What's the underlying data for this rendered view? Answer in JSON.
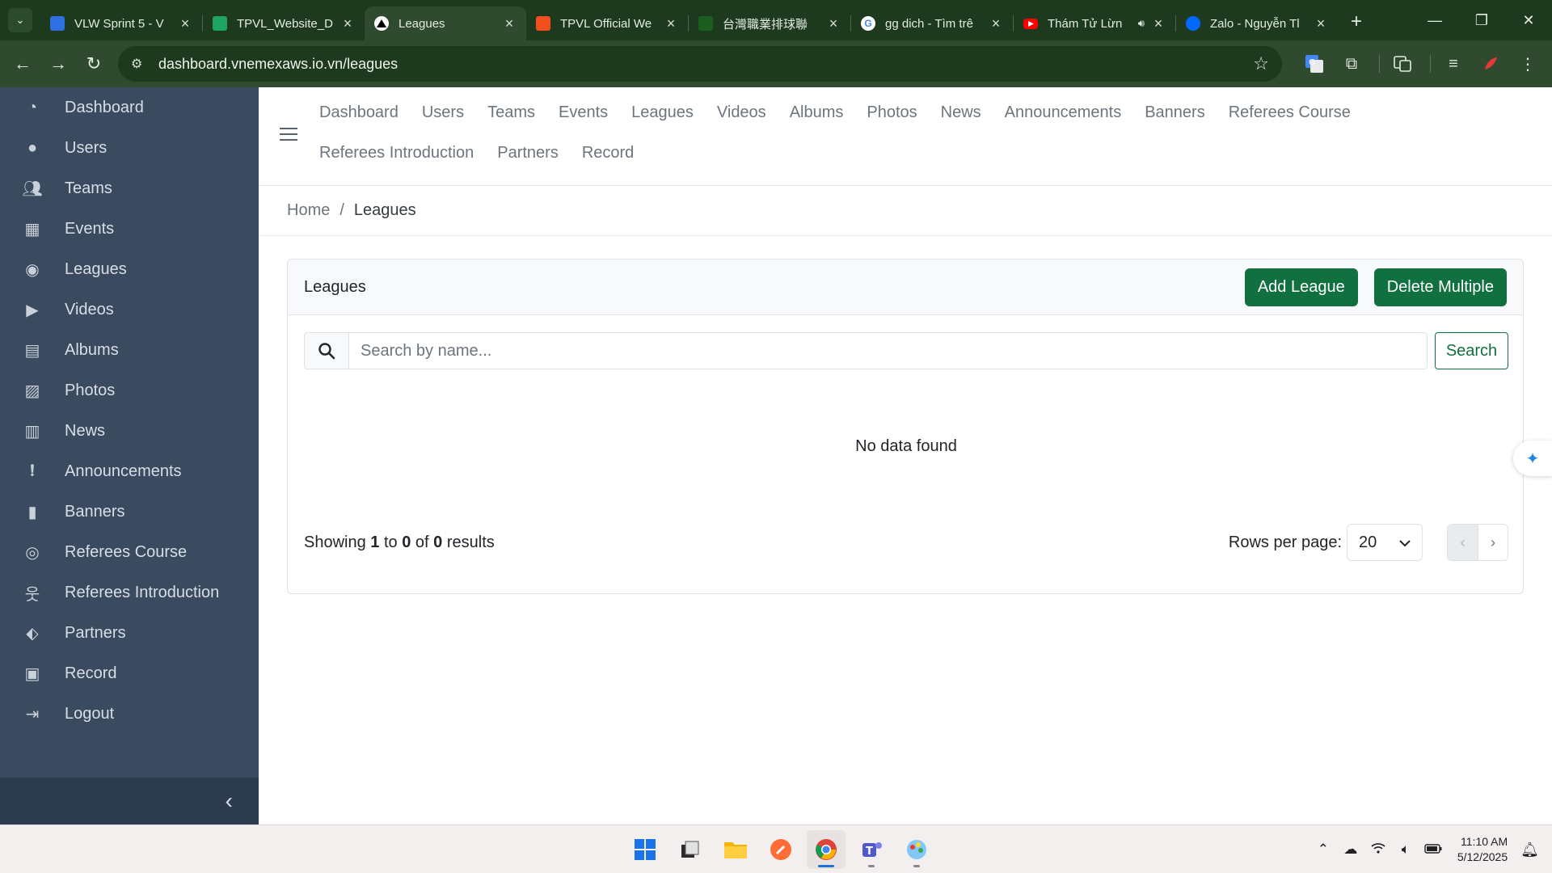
{
  "browser": {
    "tabs": [
      {
        "title": "VLW Sprint 5 - V",
        "icon": "jira-icon",
        "color": "#2f6fe0",
        "active": false
      },
      {
        "title": "TPVL_Website_D",
        "icon": "sheets-icon",
        "color": "#1ea362",
        "active": false
      },
      {
        "title": "Leagues",
        "icon": "vercel-icon",
        "color": "#000000",
        "active": true
      },
      {
        "title": "TPVL Official We",
        "icon": "figma-icon",
        "color": "#f24e1e",
        "active": false
      },
      {
        "title": "台灣職業排球聯",
        "icon": "league-icon",
        "color": "#1b5e20",
        "active": false
      },
      {
        "title": "gg dich - Tìm trê",
        "icon": "google-icon",
        "color": "#ffffff",
        "active": false
      },
      {
        "title": "Thám Tử Lừn",
        "icon": "youtube-icon",
        "color": "#ff0000",
        "active": false,
        "audio": true
      },
      {
        "title": "Zalo - Nguyễn Tl",
        "icon": "zalo-icon",
        "color": "#0068ff",
        "active": false
      }
    ],
    "url": "dashboard.vnemexaws.io.vn/leagues"
  },
  "sidebar": {
    "items": [
      {
        "label": "Dashboard",
        "icon": "gauge-icon"
      },
      {
        "label": "Users",
        "icon": "user-circle-icon"
      },
      {
        "label": "Teams",
        "icon": "users-icon"
      },
      {
        "label": "Events",
        "icon": "calendar-icon"
      },
      {
        "label": "Leagues",
        "icon": "volleyball-icon"
      },
      {
        "label": "Videos",
        "icon": "play-icon"
      },
      {
        "label": "Albums",
        "icon": "album-icon"
      },
      {
        "label": "Photos",
        "icon": "image-icon"
      },
      {
        "label": "News",
        "icon": "newspaper-icon"
      },
      {
        "label": "Announcements",
        "icon": "comment-alert-icon"
      },
      {
        "label": "Banners",
        "icon": "banner-icon"
      },
      {
        "label": "Referees Course",
        "icon": "whistle-icon"
      },
      {
        "label": "Referees Introduction",
        "icon": "person-icon"
      },
      {
        "label": "Partners",
        "icon": "handshake-icon"
      },
      {
        "label": "Record",
        "icon": "record-icon"
      },
      {
        "label": "Logout",
        "icon": "logout-icon"
      }
    ]
  },
  "topnav": {
    "links": [
      "Dashboard",
      "Users",
      "Teams",
      "Events",
      "Leagues",
      "Videos",
      "Albums",
      "Photos",
      "News",
      "Announcements",
      "Banners",
      "Referees Course",
      "Referees Introduction",
      "Partners",
      "Record"
    ]
  },
  "breadcrumb": {
    "home": "Home",
    "separator": "/",
    "current": "Leagues"
  },
  "card": {
    "title": "Leagues",
    "add_label": "Add League",
    "delete_label": "Delete Multiple",
    "search_placeholder": "Search by name...",
    "search_button": "Search",
    "empty_text": "No data found",
    "showing_prefix": "Showing",
    "showing_from": "1",
    "showing_to_word": "to",
    "showing_to": "0",
    "showing_of_word": "of",
    "showing_total": "0",
    "showing_suffix": "results",
    "rows_label": "Rows per page:",
    "rows_value": "20",
    "prev": "‹",
    "next": "›"
  },
  "taskbar": {
    "time": "11:10 AM",
    "date": "5/12/2025"
  },
  "colors": {
    "brand_green": "#11703f",
    "sidebar_bg": "#3a4a5f",
    "chrome_bg": "#1e3a1e"
  }
}
